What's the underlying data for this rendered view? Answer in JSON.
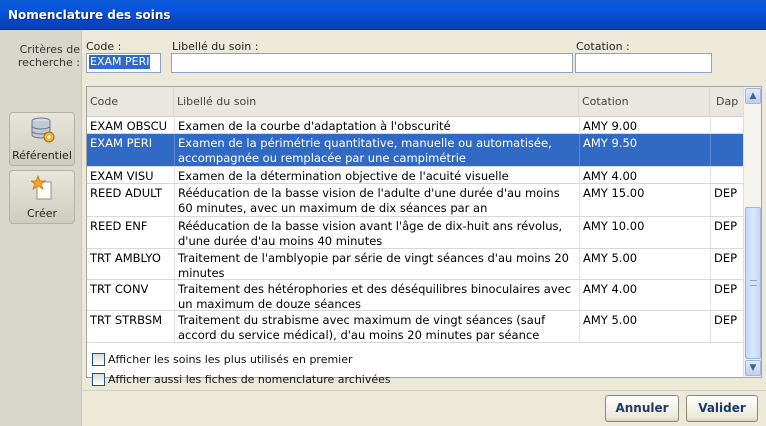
{
  "window": {
    "title": "Nomenclature des soins"
  },
  "sidebar": {
    "criteria_label": "Critères de recherche :",
    "buttons": [
      {
        "label": "Référentiel",
        "icon": "database-gear-icon"
      },
      {
        "label": "Créer",
        "icon": "new-star-icon"
      }
    ]
  },
  "search": {
    "code_label": "Code :",
    "code_value": "EXAM PERI",
    "libelle_label": "Libellé du soin :",
    "libelle_value": "",
    "cotation_label": "Cotation :",
    "cotation_value": ""
  },
  "table": {
    "headers": {
      "code": "Code",
      "libelle": "Libellé du soin",
      "cotation": "Cotation",
      "dap": "Dap"
    },
    "rows": [
      {
        "code": "EXAM OBSCU",
        "libelle": "Examen de la courbe d'adaptation à l'obscurité",
        "cotation": "AMY 9.00",
        "dap": ""
      },
      {
        "code": "EXAM PERI",
        "libelle": "Examen de la périmétrie quantitative, manuelle ou automatisée, accompagnée ou remplacée par une campimétrie",
        "cotation": "AMY 9.50",
        "dap": "",
        "selected": true
      },
      {
        "code": "EXAM VISU",
        "libelle": "Examen de la détermination objective de l'acuité visuelle",
        "cotation": "AMY 4.00",
        "dap": ""
      },
      {
        "code": "REED ADULT",
        "libelle": "Rééducation de la basse vision de l'adulte d'une durée d'au moins 60 minutes, avec un maximum de dix séances par an",
        "cotation": "AMY 15.00",
        "dap": "DEP"
      },
      {
        "code": "REED ENF",
        "libelle": "Rééducation de la basse vision avant l'âge de dix-huit ans révolus, d'une durée d'au moins 40 minutes",
        "cotation": "AMY 10.00",
        "dap": "DEP"
      },
      {
        "code": "TRT AMBLYO",
        "libelle": "Traitement de l'amblyopie par série de vingt séances d'au moins 20 minutes",
        "cotation": "AMY 5.00",
        "dap": "DEP"
      },
      {
        "code": "TRT CONV",
        "libelle": "Traitement des hétérophories et des déséquilibres binoculaires avec un maximum de douze séances",
        "cotation": "AMY 4.00",
        "dap": "DEP"
      },
      {
        "code": "TRT STRBSM",
        "libelle": "Traitement du strabisme avec maximum de vingt séances (sauf accord du service médical), d'au moins 20 minutes par séance",
        "cotation": "AMY 5.00",
        "dap": "DEP"
      }
    ]
  },
  "options": {
    "most_used_first": {
      "label": "Afficher les soins les plus utilisés en premier",
      "checked": false
    },
    "show_archived": {
      "label": "Afficher aussi les fiches de nomenclature archivées",
      "checked": false
    }
  },
  "footer": {
    "cancel_label": "Annuler",
    "validate_label": "Valider"
  },
  "colors": {
    "selection": "#316ac5",
    "titlebar": "#0855dd"
  }
}
